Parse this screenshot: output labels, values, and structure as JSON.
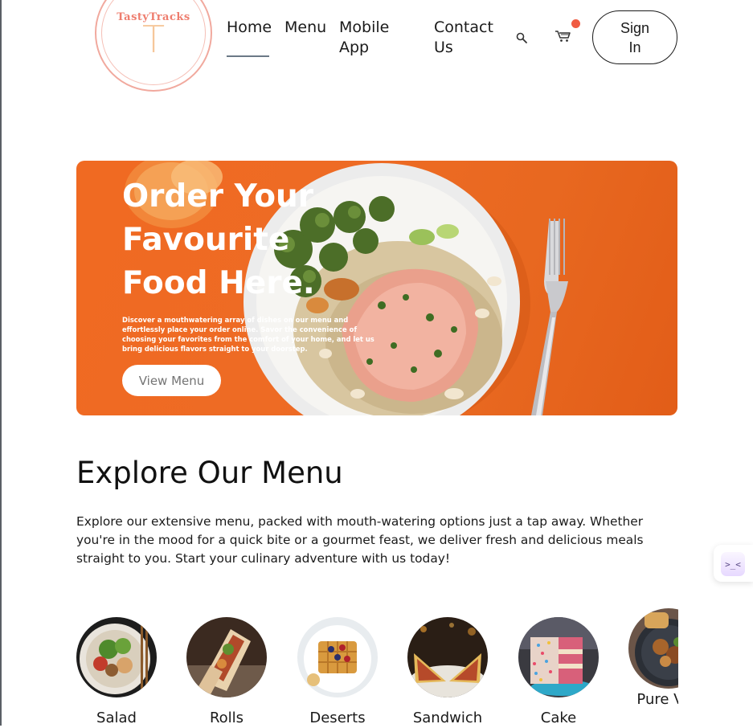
{
  "brand": {
    "logo_text": "TastyTracks",
    "logo_letter": "T"
  },
  "nav": {
    "home": "Home",
    "menu": "Menu",
    "mobile_app": "Mobile App",
    "contact": "Contact Us",
    "active": "Home"
  },
  "header": {
    "search_icon": "search-icon",
    "cart_icon": "cart-icon",
    "cart_has_notification": true,
    "signin_label": "Sign In"
  },
  "hero": {
    "title": "Order Your Favourite Food Here.",
    "description": "Discover a mouthwatering array of dishes on our menu and effortlessly place your order online. Savor the convenience of choosing your favorites from the comfort of your home, and let us bring delicious flavors straight to your doorstep.",
    "button_label": "View Menu"
  },
  "explore": {
    "title": "Explore Our Menu",
    "description": "Explore our extensive menu, packed with mouth-watering options just a tap away. Whether you're in the mood for a quick bite or a gourmet feast, we deliver fresh and delicious meals straight to you. Start your culinary adventure with us today!"
  },
  "categories": [
    {
      "label": "Salad"
    },
    {
      "label": "Rolls"
    },
    {
      "label": "Deserts"
    },
    {
      "label": "Sandwich"
    },
    {
      "label": "Cake"
    },
    {
      "label": "Pure Veg"
    }
  ],
  "colors": {
    "accent": "#f06a22",
    "notification": "#f05b42",
    "logo": "#ee7d6e"
  },
  "widget": {
    "glyph": ">_<"
  }
}
